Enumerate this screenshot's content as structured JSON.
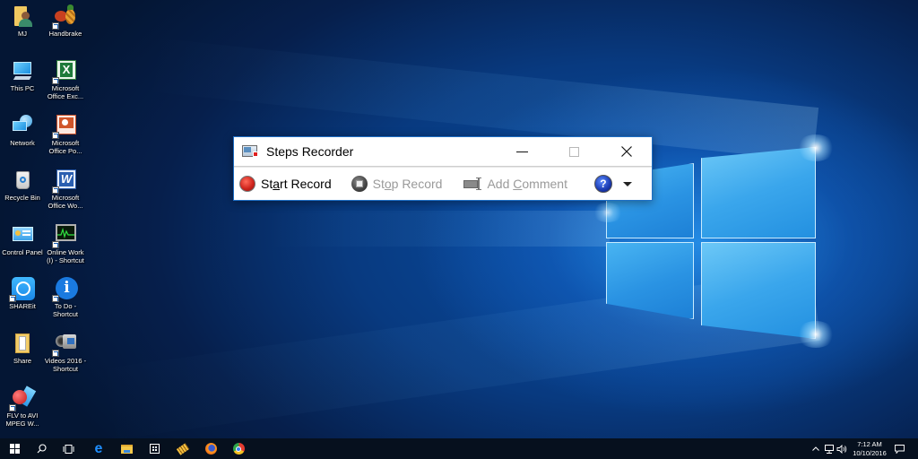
{
  "desktop": {
    "icons": [
      {
        "label": "MJ",
        "icon": "user-folder-icon"
      },
      {
        "label": "Handbrake",
        "icon": "handbrake-icon",
        "shortcut": true
      },
      {
        "label": "This PC",
        "icon": "computer-icon"
      },
      {
        "label": "Microsoft Office Exc...",
        "icon": "excel-icon",
        "shortcut": true
      },
      {
        "label": "Network",
        "icon": "network-icon"
      },
      {
        "label": "Microsoft Office Po...",
        "icon": "powerpoint-icon",
        "shortcut": true
      },
      {
        "label": "Recycle Bin",
        "icon": "recycle-bin-icon"
      },
      {
        "label": "Microsoft Office Wo...",
        "icon": "word-icon",
        "shortcut": true
      },
      {
        "label": "Control Panel",
        "icon": "control-panel-icon"
      },
      {
        "label": "Online Work (I) - Shortcut",
        "icon": "monitor-graph-icon",
        "shortcut": true
      },
      {
        "label": "SHAREit",
        "icon": "shareit-icon",
        "shortcut": true
      },
      {
        "label": "To Do - Shortcut",
        "icon": "info-icon",
        "shortcut": true
      },
      {
        "label": "Share",
        "icon": "folder-icon"
      },
      {
        "label": "Videos 2016 - Shortcut",
        "icon": "camcorder-icon",
        "shortcut": true
      },
      {
        "label": "FLV to AVI MPEG W...",
        "icon": "video-converter-icon",
        "shortcut": true
      }
    ]
  },
  "window": {
    "title": "Steps Recorder",
    "controls": {
      "minimize": "—",
      "maximize": "☐",
      "close": "✕"
    },
    "toolbar": {
      "start_record": {
        "pre": "St",
        "accel": "a",
        "post": "rt Record",
        "enabled": true
      },
      "stop_record": {
        "pre": "St",
        "accel": "o",
        "post": "p Record",
        "enabled": false
      },
      "add_comment": {
        "pre": "Add ",
        "accel": "C",
        "post": "omment",
        "enabled": false
      },
      "help": "?",
      "dropdown": "▾"
    },
    "colors": {
      "record_red": "#d0261e",
      "border_blue": "#1e6fc5",
      "disabled_text": "#9a9a9a"
    }
  },
  "taskbar": {
    "pinned": [
      "start-icon",
      "search-icon",
      "task-view-icon",
      "edge-icon",
      "file-explorer-icon",
      "store-icon",
      "media-app-icon",
      "firefox-icon",
      "chrome-icon"
    ],
    "tray": {
      "chevron": "^",
      "time": "7:12 AM",
      "date": "10/10/2016"
    }
  }
}
